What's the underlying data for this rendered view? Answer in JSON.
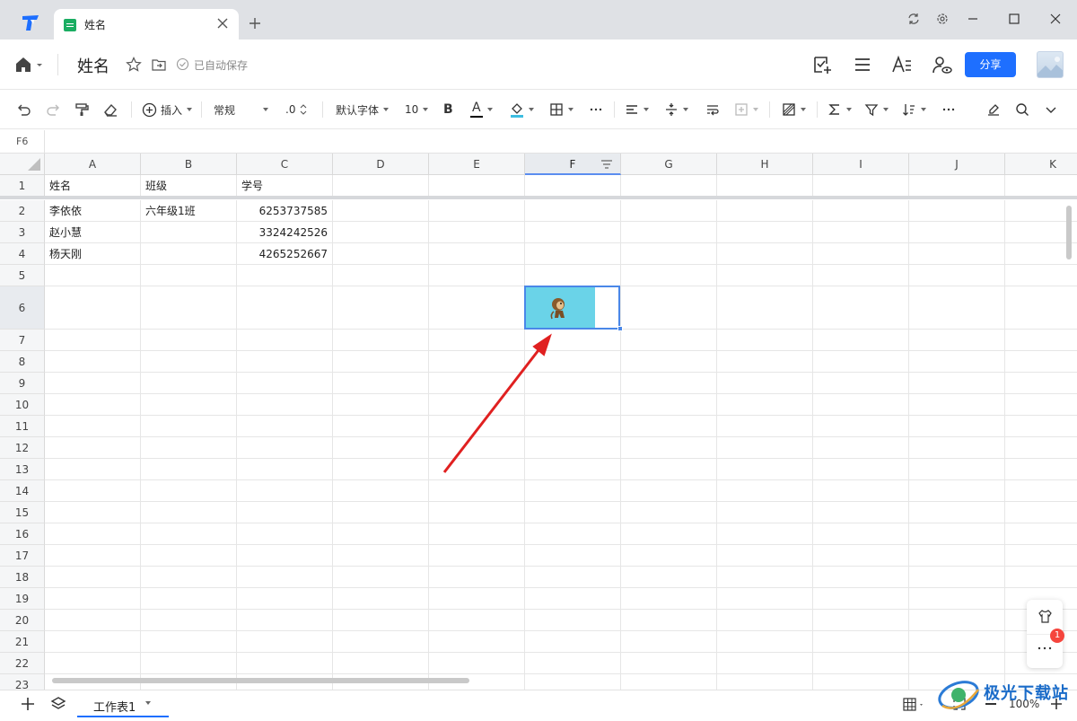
{
  "tab": {
    "title": "姓名"
  },
  "doc": {
    "title": "姓名",
    "saved_status": "已自动保存",
    "share_label": "分享"
  },
  "toolbar": {
    "insert_label": "插入",
    "format_label": "常规",
    "decimal_label": ".0",
    "font_label": "默认字体",
    "font_size": "10",
    "bold_label": "B",
    "font_color_label": "A",
    "font_color": "#000000",
    "fill_color": "#3dbde0"
  },
  "formula_bar": {
    "cell_ref": "F6"
  },
  "grid": {
    "columns": [
      "A",
      "B",
      "C",
      "D",
      "E",
      "F",
      "G",
      "H",
      "I",
      "J",
      "K"
    ],
    "rows": [
      "1",
      "2",
      "3",
      "4",
      "5",
      "6",
      "7",
      "8",
      "9",
      "10",
      "11",
      "12",
      "13",
      "14",
      "15",
      "16",
      "17",
      "18",
      "19",
      "20",
      "21",
      "22",
      "23"
    ],
    "selected_cell": "F6",
    "cells": {
      "A1": "姓名",
      "B1": "班级",
      "C1": "学号",
      "A2": "李依依",
      "B2": "六年级1班",
      "C2": "6253737585",
      "A3": "赵小慧",
      "C3": "3324242526",
      "A4": "杨天刚",
      "C4": "4265252667"
    },
    "cell_image": "monkey-character-icon"
  },
  "floating_panel": {
    "badge_count": "1"
  },
  "bottom": {
    "sheet_name": "工作表1",
    "zoom": "100%"
  },
  "watermark": {
    "text": "极光下载站"
  },
  "colors": {
    "accent": "#1e6fff",
    "selection": "#4a87e8",
    "arrow": "#e02020"
  }
}
